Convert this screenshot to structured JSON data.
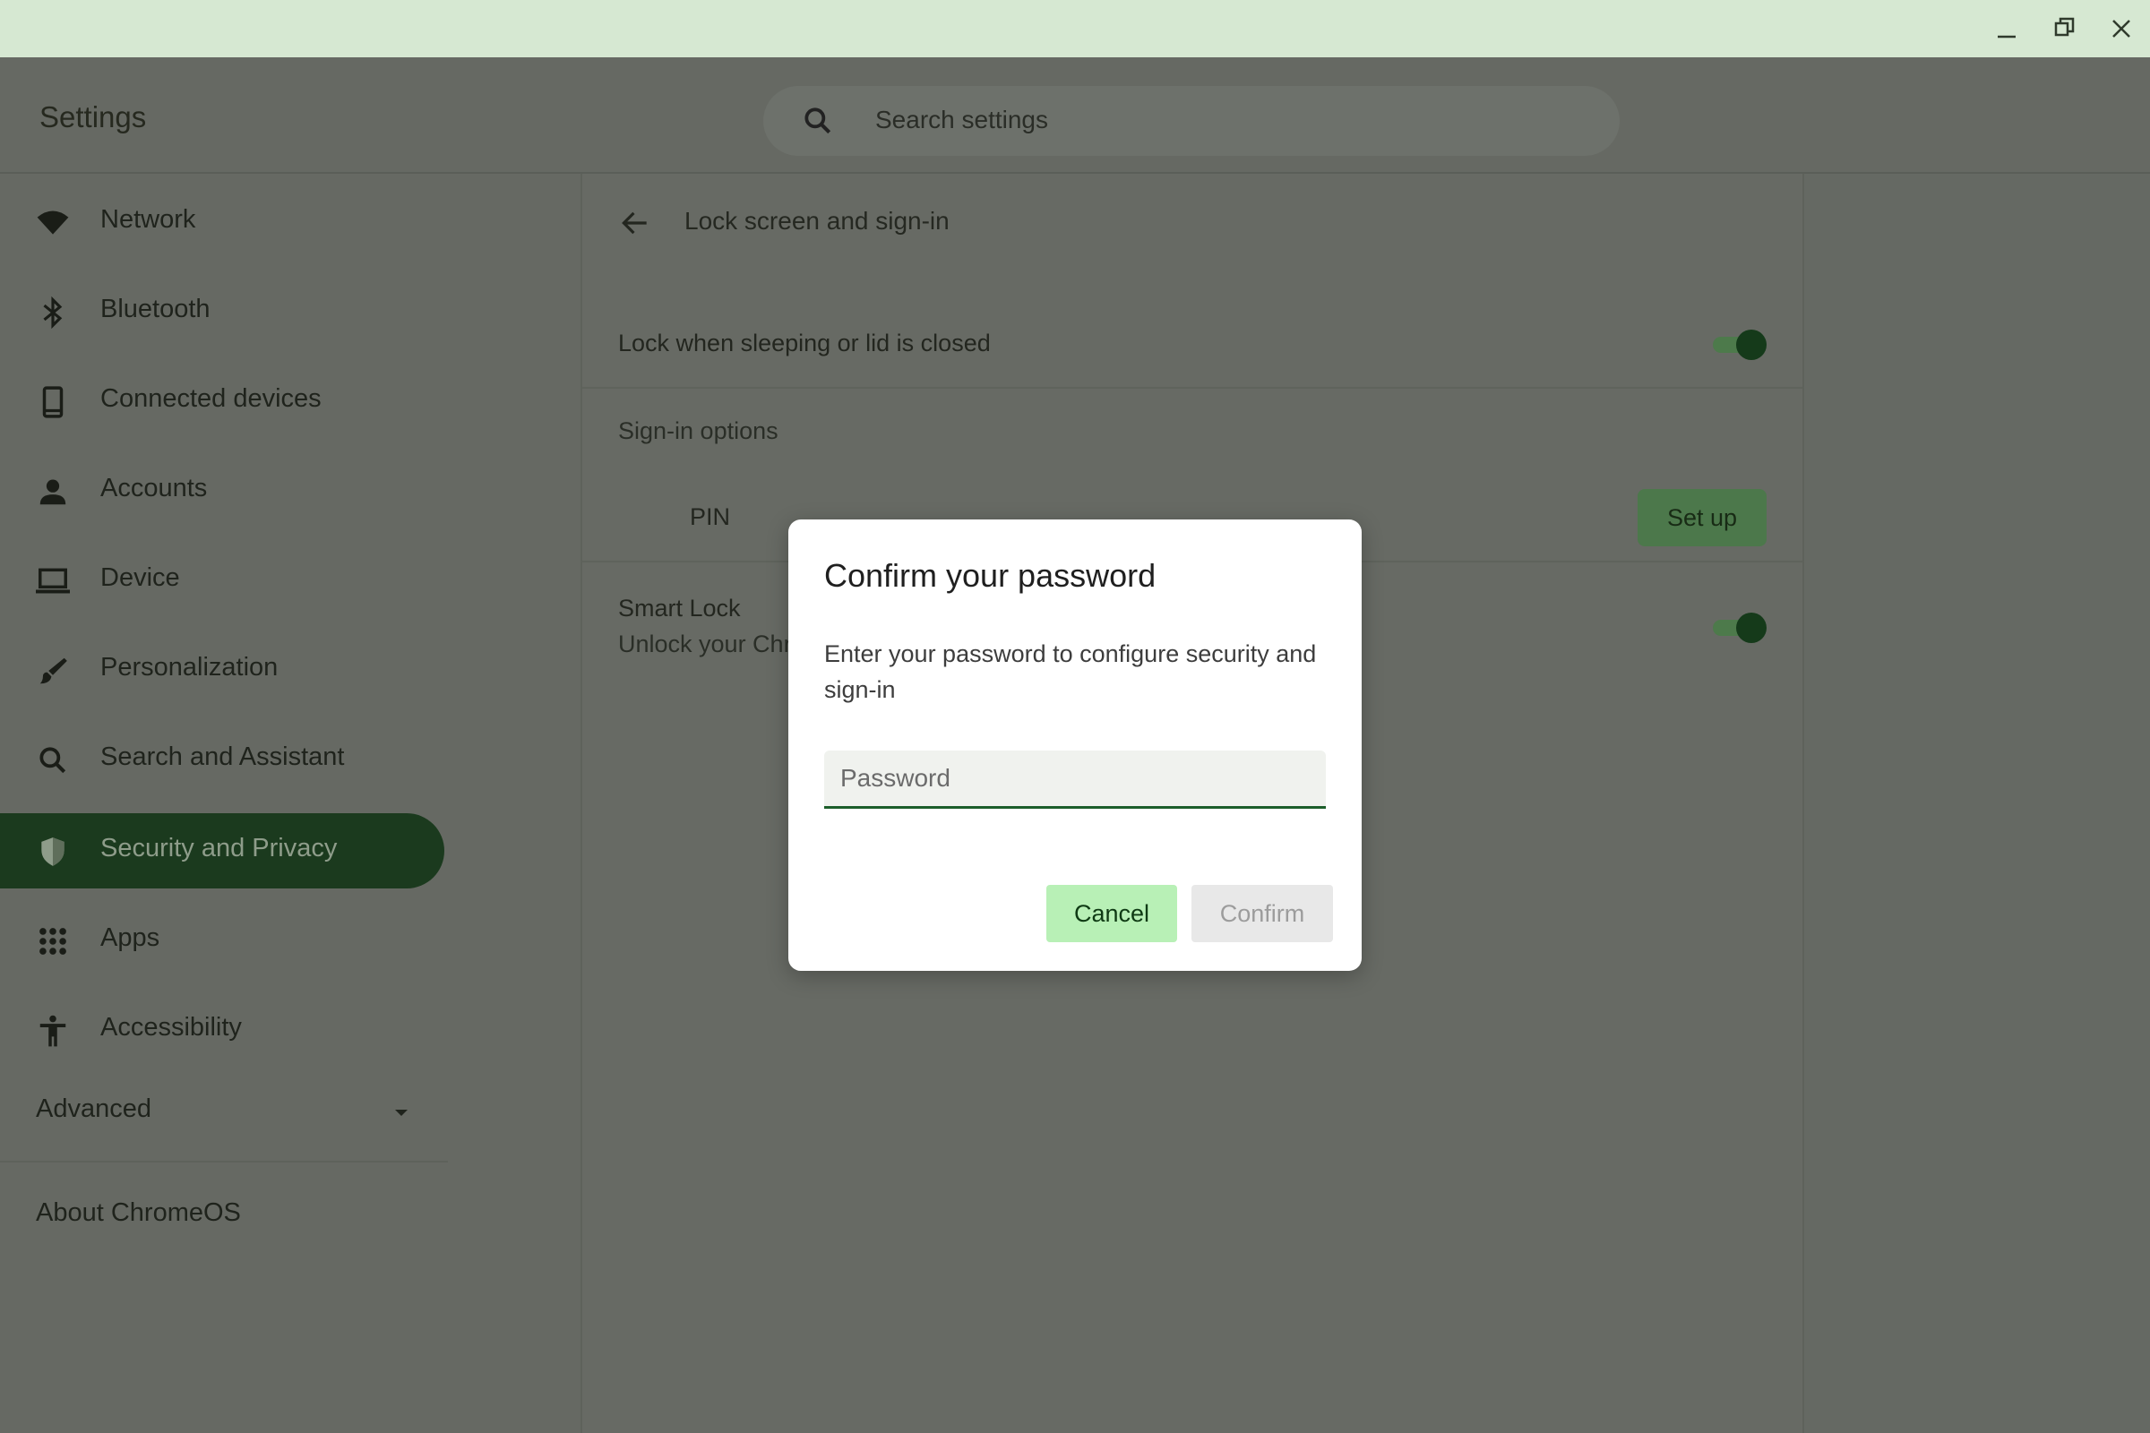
{
  "window": {
    "controls": [
      {
        "icon": "minimize-icon"
      },
      {
        "icon": "restore-icon"
      },
      {
        "icon": "close-icon"
      }
    ]
  },
  "header": {
    "title": "Settings",
    "search_placeholder": "Search settings"
  },
  "sidebar": {
    "items": [
      {
        "label": "Network",
        "icon": "wifi-icon"
      },
      {
        "label": "Bluetooth",
        "icon": "bluetooth-icon"
      },
      {
        "label": "Connected devices",
        "icon": "phone-icon"
      },
      {
        "label": "Accounts",
        "icon": "person-icon"
      },
      {
        "label": "Device",
        "icon": "laptop-icon"
      },
      {
        "label": "Personalization",
        "icon": "brush-icon"
      },
      {
        "label": "Search and Assistant",
        "icon": "search-icon"
      },
      {
        "label": "Security and Privacy",
        "icon": "shield-icon",
        "active": true
      },
      {
        "label": "Apps",
        "icon": "apps-grid-icon"
      },
      {
        "label": "Accessibility",
        "icon": "accessibility-icon"
      }
    ],
    "advanced_label": "Advanced",
    "about_label": "About ChromeOS"
  },
  "main": {
    "page_title": "Lock screen and sign-in",
    "lock_when_sleeping": {
      "label": "Lock when sleeping or lid is closed",
      "enabled": true
    },
    "signin_options_heading": "Sign-in options",
    "pin": {
      "label": "PIN",
      "button": "Set up"
    },
    "smart_lock": {
      "label": "Smart Lock",
      "sublabel": "Unlock your Chr",
      "enabled": true
    }
  },
  "dialog": {
    "title": "Confirm your password",
    "body": "Enter your password to configure security and sign-in",
    "password_placeholder": "Password",
    "password_value": "",
    "cancel_label": "Cancel",
    "confirm_label": "Confirm",
    "confirm_enabled": false
  },
  "colors": {
    "titlebar": "#d6e8d2",
    "scrim": "#656963",
    "active_nav": "#1b3a1e",
    "accent": "#1c5e2a",
    "cancel_button": "#b8f0b6"
  }
}
